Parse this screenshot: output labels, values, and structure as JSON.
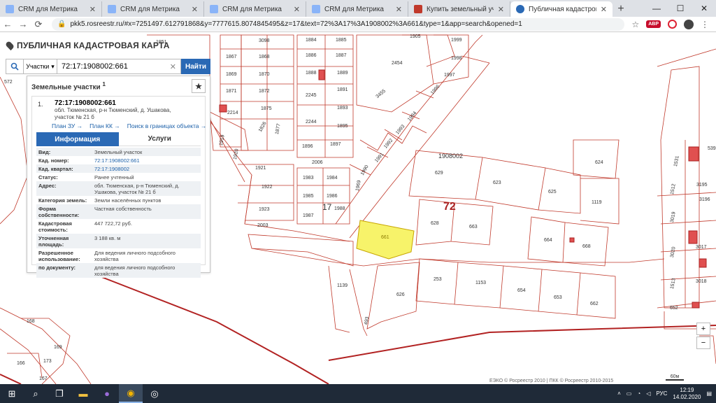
{
  "browser": {
    "tabs": [
      {
        "label": "CRM для Метрика",
        "active": false
      },
      {
        "label": "CRM для Метрика",
        "active": false
      },
      {
        "label": "CRM для Метрика",
        "active": false
      },
      {
        "label": "CRM для Метрика",
        "active": false
      },
      {
        "label": "Купить земельный участок",
        "active": false
      },
      {
        "label": "Публичная кадастровая к",
        "active": true
      }
    ],
    "url": "pkk5.rosreestr.ru/#x=7251497.612791868&y=7777615.8074845495&z=17&text=72%3A17%3A1908002%3A661&type=1&app=search&opened=1",
    "abp_label": "ABP"
  },
  "app": {
    "title": "ПУБЛИЧНАЯ КАДАСТРОВАЯ КАРТА"
  },
  "search": {
    "type_label": "Участки",
    "query": "72:17:1908002:661",
    "find_label": "Найти"
  },
  "panel": {
    "title": "Земельные участки",
    "count": "1",
    "item": {
      "number": "1.",
      "cad_number": "72:17:1908002:661",
      "address_line1": "обл. Тюменская, р-н Тюменский, д. Ушакова,",
      "address_line2": "участок № 21 б",
      "links": [
        "План ЗУ →",
        "План КК →",
        "Поиск в границах объекта →"
      ],
      "tabs": [
        "Информация",
        "Услуги"
      ],
      "rows": [
        {
          "k": "Вид:",
          "v": "Земельный участок",
          "link": false
        },
        {
          "k": "Кад. номер:",
          "v": "72:17:1908002:661",
          "link": true
        },
        {
          "k": "Кад. квартал:",
          "v": "72:17:1908002",
          "link": true
        },
        {
          "k": "Статус:",
          "v": "Ранее учтенный",
          "link": false
        },
        {
          "k": "Адрес:",
          "v": "обл. Тюменская, р-н Тюменский, д. Ушакова, участок № 21 б",
          "link": false
        },
        {
          "k": "Категория земель:",
          "v": "Земли населённых пунктов",
          "link": false
        },
        {
          "k": "Форма собственности:",
          "v": "Частная собственность",
          "link": false
        },
        {
          "k": "Кадастровая стоимость:",
          "v": "447 722,72 руб.",
          "link": false
        },
        {
          "k": "Уточненная площадь:",
          "v": "3 188 кв. м",
          "link": false
        },
        {
          "k": "Разрешенное использование:",
          "v": "Для ведения личного подсобного хозяйства",
          "link": false
        },
        {
          "k": "по документу:",
          "v": "для ведения личного подсобного хозяйства",
          "link": false
        }
      ]
    }
  },
  "map": {
    "labels": {
      "quarter": "1908002",
      "big": "72",
      "small17": "17",
      "selected": "661"
    },
    "parcels": [
      "1851",
      "3098",
      "1884",
      "1885",
      "1905",
      "1999",
      "1998",
      "1867",
      "1868",
      "1886",
      "1887",
      "2454",
      "1997",
      "1869",
      "1870",
      "1888",
      "1889",
      "1871",
      "1872",
      "2245",
      "1891",
      "3455",
      "1996",
      "2214",
      "1875",
      "1893",
      "1994",
      "1826",
      "1877",
      "2244",
      "1895",
      "1993",
      "1896",
      "1897",
      "1992",
      "1920",
      "1919",
      "2006",
      "1991",
      "1921",
      "1983",
      "1984",
      "1990",
      "1922",
      "1969",
      "1985",
      "1986",
      "1923",
      "1987",
      "1988",
      "2003",
      "629",
      "623",
      "625",
      "624",
      "1119",
      "628",
      "663",
      "664",
      "668",
      "253",
      "1153",
      "654",
      "653",
      "662",
      "626",
      "1139",
      "493",
      "572",
      "168",
      "169",
      "173",
      "166",
      "167",
      "1531",
      "539",
      "3195",
      "3196",
      "1512",
      "3019",
      "3017",
      "3018",
      "1513",
      "3020",
      "652"
    ],
    "copyright": "ЕЭКО © Росреестр 2010 | ПКК © Росреестр 2010-2015",
    "scale": "60м"
  },
  "taskbar": {
    "lang": "РУС",
    "time": "12:19",
    "date": "14.02.2020"
  }
}
